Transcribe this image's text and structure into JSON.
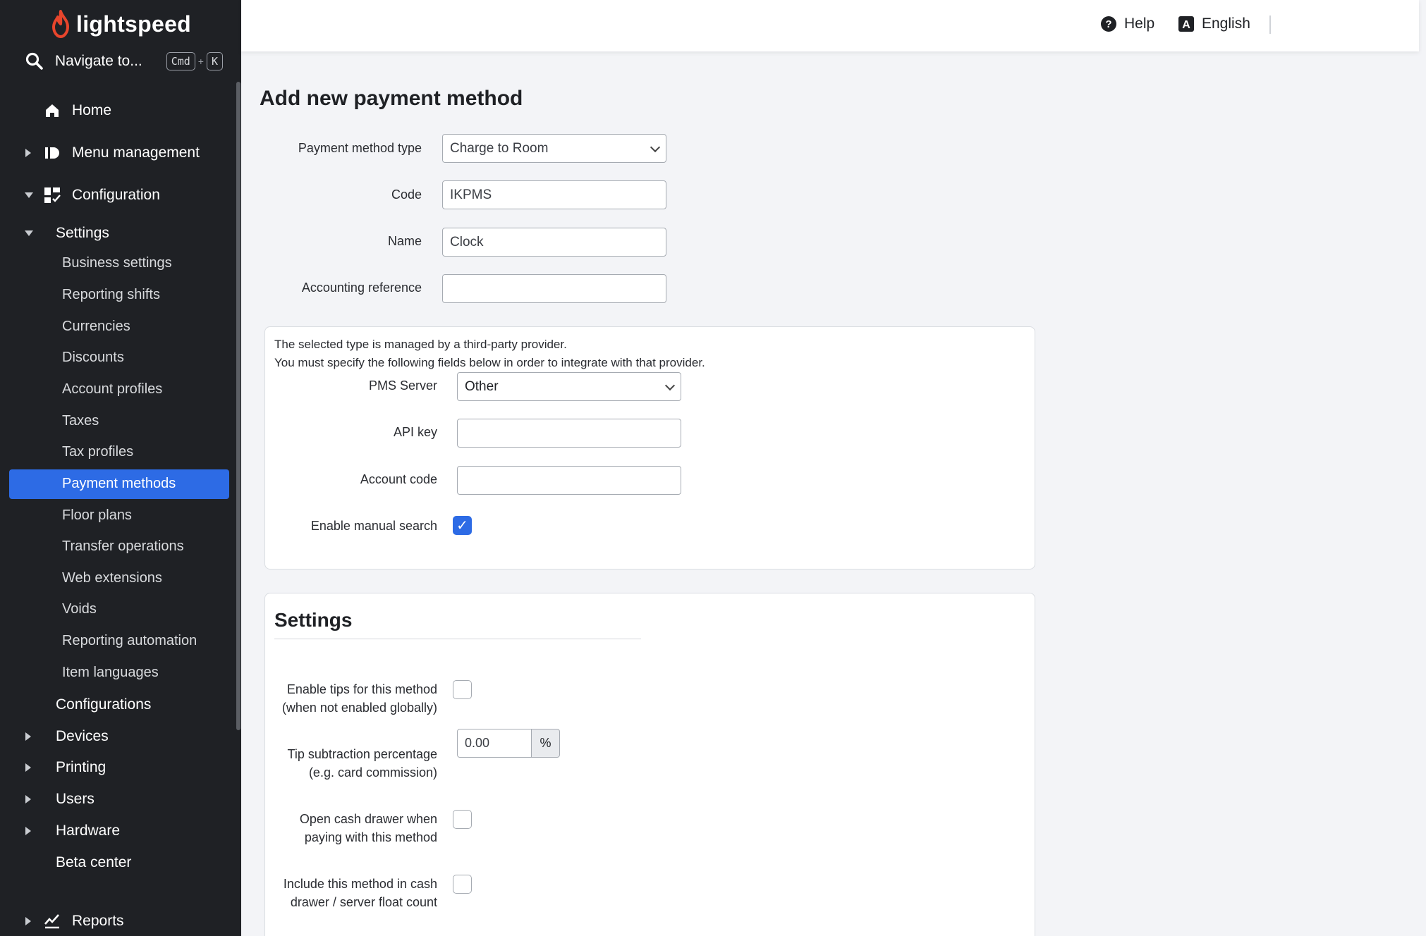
{
  "sidebar": {
    "brand": "lightspeed",
    "navigate_label": "Navigate to...",
    "shortcut": {
      "key1": "Cmd",
      "plus": "+",
      "key2": "K"
    },
    "home": "Home",
    "menu_management": "Menu management",
    "configuration": "Configuration",
    "settings": "Settings",
    "settings_items": [
      "Business settings",
      "Reporting shifts",
      "Currencies",
      "Discounts",
      "Account profiles",
      "Taxes",
      "Tax profiles",
      "Payment methods",
      "Floor plans",
      "Transfer operations",
      "Web extensions",
      "Voids",
      "Reporting automation",
      "Item languages"
    ],
    "configurations": "Configurations",
    "devices": "Devices",
    "printing": "Printing",
    "users": "Users",
    "hardware": "Hardware",
    "beta_center": "Beta center",
    "reports": "Reports"
  },
  "topbar": {
    "help": "Help",
    "language": "English"
  },
  "page": {
    "title": "Add new payment method",
    "fields": {
      "type_label": "Payment method type",
      "type_value": "Charge to Room",
      "code_label": "Code",
      "code_value": "IKPMS",
      "name_label": "Name",
      "name_value": "Clock",
      "accounting_label": "Accounting reference",
      "accounting_value": ""
    },
    "provider_panel": {
      "line1": "The selected type is managed by a third-party provider.",
      "line2": "You must specify the following fields below in order to integrate with that provider.",
      "pms_label": "PMS Server",
      "pms_value": "Other",
      "api_label": "API key",
      "api_value": "",
      "account_label": "Account code",
      "account_value": "",
      "manual_search_label": "Enable manual search",
      "manual_search_checked": true
    },
    "settings_panel": {
      "title": "Settings",
      "tips_label_1": "Enable tips for this method",
      "tips_label_2": "(when not enabled globally)",
      "tip_sub_label_1": "Tip subtraction percentage",
      "tip_sub_label_2": "(e.g. card commission)",
      "tip_sub_value": "0.00",
      "tip_sub_unit": "%",
      "drawer_label_1": "Open cash drawer when",
      "drawer_label_2": "paying with this method",
      "float_label_1": "Include this method in cash",
      "float_label_2": "drawer / server float count"
    }
  },
  "colors": {
    "sidebar_bg": "#1f2125",
    "accent": "#2d6be5",
    "brand_red": "#e8452c"
  }
}
